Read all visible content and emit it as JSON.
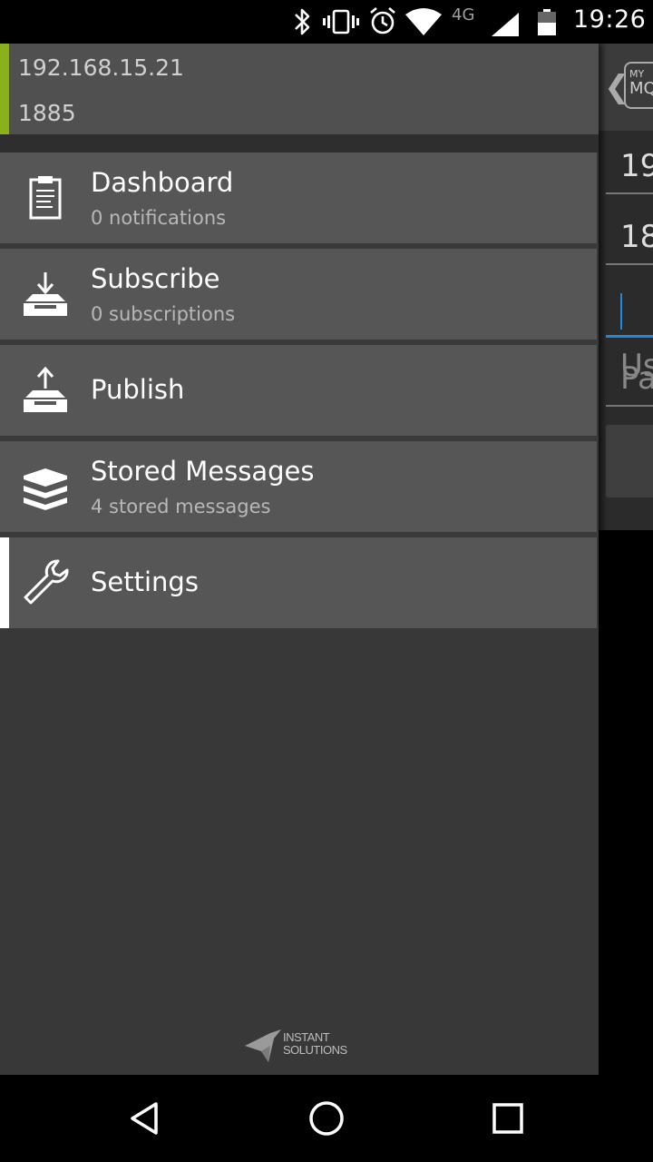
{
  "status_bar": {
    "time": "19:26",
    "network": "4G",
    "icons": [
      "bluetooth-icon",
      "vibrate-icon",
      "alarm-icon",
      "wifi-icon",
      "signal-icon",
      "battery-icon"
    ]
  },
  "drawer": {
    "header": {
      "host": "192.168.15.21",
      "port": "1885",
      "accent_color": "#8ab01b"
    },
    "items": [
      {
        "name": "dashboard",
        "label": "Dashboard",
        "sublabel": "0 notifications",
        "icon": "clipboard-icon"
      },
      {
        "name": "subscribe",
        "label": "Subscribe",
        "sublabel": "0 subscriptions",
        "icon": "tray-download-icon"
      },
      {
        "name": "publish",
        "label": "Publish",
        "sublabel": "",
        "icon": "tray-upload-icon"
      },
      {
        "name": "stored-messages",
        "label": "Stored Messages",
        "sublabel": "4 stored messages",
        "icon": "layers-icon"
      },
      {
        "name": "settings",
        "label": "Settings",
        "sublabel": "",
        "icon": "wrench-icon",
        "selected": true
      }
    ],
    "brand": {
      "line1": "INSTANT",
      "line2": "SOLUTIONS"
    }
  },
  "background_app": {
    "logo_top": "MY",
    "logo_bottom": "MQ",
    "field1_value": "19",
    "field2_value": "18",
    "username_placeholder": "Us",
    "password_placeholder": "Pa"
  },
  "nav_bar": {
    "buttons": [
      "back-icon",
      "home-icon",
      "recents-icon"
    ]
  }
}
